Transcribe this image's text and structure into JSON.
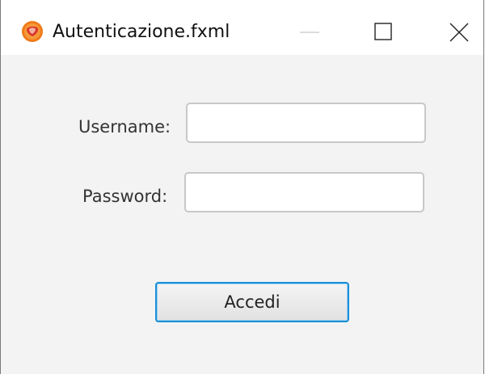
{
  "window": {
    "title": "Autenticazione.fxml",
    "controls": [
      "minimize",
      "maximize",
      "close"
    ],
    "app_icon": "java-app-icon"
  },
  "form": {
    "username_label": "Username:",
    "username_value": "",
    "password_label": "Password:",
    "password_value": "",
    "submit_label": "Accedi"
  },
  "colors": {
    "titlebar_bg": "#ffffff",
    "content_bg": "#f3f3f3",
    "focus_border": "#1a8fd6",
    "app_icon": "#f07a18"
  }
}
